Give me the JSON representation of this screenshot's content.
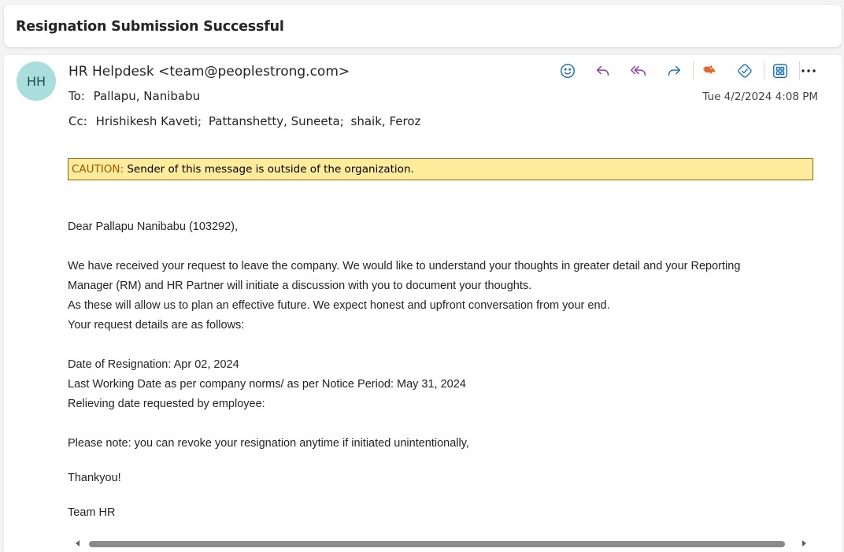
{
  "subject": "Resignation Submission Successful",
  "sender": {
    "initials": "HH",
    "display": "HR Helpdesk <team@peoplestrong.com>",
    "avatar_color": "#a9dedd"
  },
  "recipients": {
    "to_label": "To:",
    "to": "Pallapu, Nanibabu",
    "cc_label": "Cc:",
    "cc": [
      "Hrishikesh Kaveti;",
      "Pattanshetty, Suneeta;",
      "shaik, Feroz"
    ]
  },
  "date": "Tue 4/2/2024 4:08 PM",
  "toolbar": {
    "icons": [
      "emoji-icon",
      "reply-icon",
      "reply-all-icon",
      "forward-icon",
      "report-phishing-icon",
      "sticker-icon",
      "apps-icon",
      "more-icon"
    ]
  },
  "caution": {
    "keyword": "CAUTION:",
    "text": " Sender of this message is outside of the organization.",
    "bg": "#ffeb9c"
  },
  "body": {
    "greeting": "Dear Pallapu Nanibabu (103292),",
    "line1": "We have received your request to leave the company. We would like to understand your thoughts in greater detail and your Reporting",
    "line2": "Manager (RM) and HR Partner will initiate a discussion with you to document your thoughts.",
    "line3": "As these will allow us to plan an effective future. We expect honest and upfront conversation from your end.",
    "line4": "Your request details are as follows:",
    "detail1": "Date of Resignation: Apr 02, 2024",
    "detail2": "Last Working Date as per company norms/ as per Notice Period: May 31, 2024",
    "detail3": "Relieving date requested by employee:",
    "note": "Please note: you can revoke your resignation anytime if initiated unintentionally,",
    "thanks": "Thankyou!",
    "signoff": "Team HR"
  }
}
